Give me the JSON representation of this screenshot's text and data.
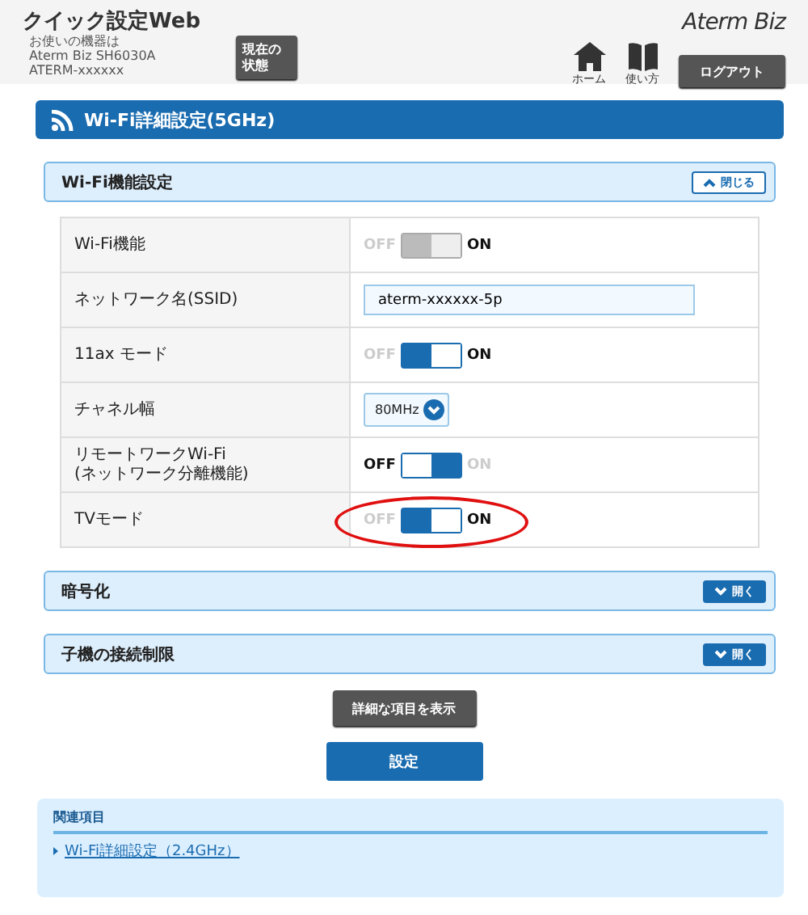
{
  "header": {
    "app_title": "クイック設定Web",
    "device_lines": [
      "お使いの機器は",
      "Aterm Biz SH6030A",
      "ATERM-xxxxxx"
    ],
    "status_button": [
      "現在の",
      "状態"
    ],
    "nav": [
      {
        "label": "ホーム"
      },
      {
        "label": "使い方"
      }
    ],
    "logout_button": "ログアウト",
    "logo": "Aterm Biz"
  },
  "page_title": "Wi-Fi詳細設定(5GHz)",
  "sections": [
    {
      "title": "Wi-Fi機能設定",
      "expanded": true,
      "toggle_label": "閉じる",
      "rows": [
        {
          "kind": "toggle",
          "label": "Wi-Fi機能",
          "off_label": "OFF",
          "on_label": "ON",
          "on": true,
          "disabled": true,
          "highlighted": false
        },
        {
          "kind": "text",
          "label": "ネットワーク名(SSID)",
          "value": "aterm-xxxxxx-5p"
        },
        {
          "kind": "toggle",
          "label": "11ax モード",
          "off_label": "OFF",
          "on_label": "ON",
          "on": true,
          "disabled": false,
          "highlighted": false
        },
        {
          "kind": "select",
          "label": "チャネル幅",
          "value": "80MHz"
        },
        {
          "kind": "toggle",
          "label": "リモートワークWi-Fi\n(ネットワーク分離機能)",
          "off_label": "OFF",
          "on_label": "ON",
          "on": false,
          "disabled": false,
          "highlighted": false
        },
        {
          "kind": "toggle",
          "label": "TVモード",
          "off_label": "OFF",
          "on_label": "ON",
          "on": true,
          "disabled": false,
          "highlighted": true
        }
      ]
    },
    {
      "title": "暗号化",
      "expanded": false,
      "toggle_label": "開く"
    },
    {
      "title": "子機の接続制限",
      "expanded": false,
      "toggle_label": "開く"
    }
  ],
  "detail_button": "詳細な項目を表示",
  "submit_button": "設定",
  "related": {
    "title": "関連項目",
    "links": [
      "Wi-Fi詳細設定（2.4GHz）"
    ]
  }
}
